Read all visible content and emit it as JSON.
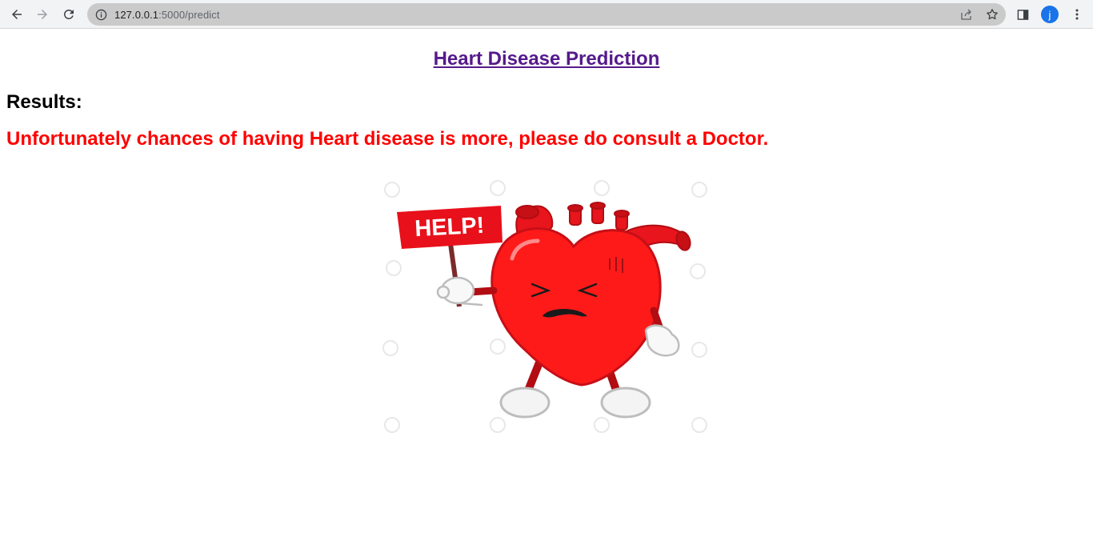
{
  "browser": {
    "url_host": "127.0.0.1",
    "url_path": ":5000/predict",
    "profile_initial": "j"
  },
  "page": {
    "title": "Heart Disease Prediction",
    "results_heading": "Results:",
    "result_message": "Unfortunately chances of having Heart disease is more, please do consult a Doctor.",
    "sign_text": "HELP!"
  },
  "colors": {
    "title_link": "#551a8b",
    "result_text": "#ff0000",
    "heart": "#ff1a1a"
  }
}
